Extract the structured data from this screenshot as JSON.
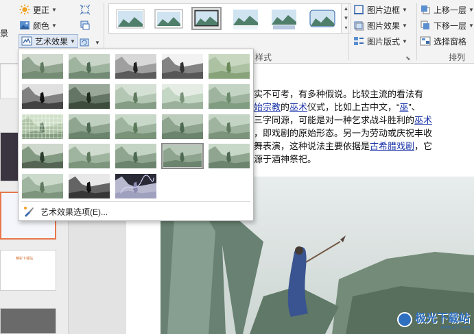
{
  "ribbon": {
    "left_cut_label": "景",
    "correct_label": "更正",
    "color_label": "颜色",
    "art_effect_label": "艺术效果",
    "picture_border_label": "图片边框",
    "picture_effect_label": "图片效果",
    "picture_layout_label": "图片版式",
    "bring_forward_label": "上移一层",
    "send_backward_label": "下移一层",
    "selection_pane_label": "选择窗格",
    "styles_group_label": "样式",
    "arrange_group_label": "排列"
  },
  "dropdown": {
    "option_label": "艺术效果选项(E)..."
  },
  "document": {
    "lines": [
      "实不可考，有多种假说。比较主流的看法有",
      "始宗教|的|巫术|仪式，比如上古中文，“巫”、",
      "三字同源，可能是对一种乞求战斗胜利的|巫术",
      "，即戏剧的原始形态。另一为劳动或庆祝丰收",
      "舞表演，这种说法主要依据是|古希腊戏剧|，它",
      "源于酒神祭祀。"
    ],
    "line1": "实不可考，有多种假说。比较主流的看法有",
    "line2a": "始宗教",
    "line2b": "的",
    "line2c": "巫术",
    "line2d": "仪式，比如上古中文，“",
    "line2e": "巫",
    "line2f": "”、",
    "line3a": "三字同源，可能是对一种乞求战斗胜利的",
    "line3b": "巫术",
    "line4": "，即戏剧的原始形态。另一为劳动或庆祝丰收",
    "line5a": "舞表演，这种说法主要依据是",
    "line5b": "古希腊戏剧",
    "line5c": "，它",
    "line6": "源于酒神祭祀。"
  },
  "slides": {
    "thumb_title": "精彩下载站"
  },
  "watermark": {
    "text": "极光下载站",
    "sub": "www.xz7.com"
  },
  "colors": {
    "accent": "#2e6fbf",
    "selected_border": "#8a8a8a",
    "slide_selection": "#e8764a",
    "link": "#1a33a8"
  }
}
